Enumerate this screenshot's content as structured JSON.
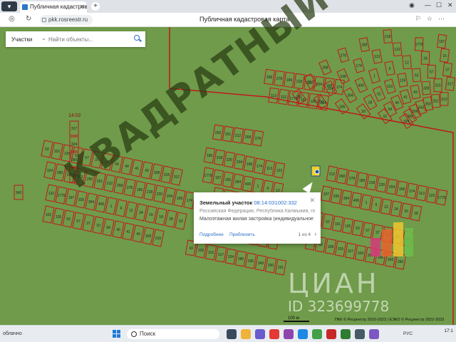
{
  "browser": {
    "tab_title": "Публичная кадастровая",
    "url": "pkk.rosreestr.ru",
    "page_title": "Публичная кадастровая карта"
  },
  "search": {
    "type_label": "Участки",
    "placeholder": "Найти объекты..."
  },
  "map": {
    "block_label": "14:02",
    "parcel_labels": [
      "52",
      "101",
      "126",
      "53",
      "57",
      "37",
      "10",
      "54",
      "40",
      "41",
      "43",
      "328",
      "315",
      "317",
      "324",
      "280",
      "296",
      "343",
      "250",
      "251",
      "212",
      "268",
      "278",
      "189",
      "218",
      "220",
      "204",
      "168",
      "174",
      "113",
      "122",
      "1779",
      "197",
      "335",
      "394",
      "406",
      "1",
      "6",
      "12",
      "24",
      "16",
      "18",
      "28"
    ],
    "boundary_color": "#c0191b",
    "parcel_color": "#c0191b",
    "map_color": "#6f9b4a"
  },
  "popup": {
    "heading": "Земельный участок",
    "cadastral_number": "08:14:031002:332",
    "address": "Российская Федерация, Республика Калмыкия, горо...",
    "use": "Малоэтажная жилая застройка (индивидуальное ж...",
    "details_link": "Подробнее",
    "zoom_link": "Приблизить",
    "page": "1 из 4"
  },
  "watermarks": {
    "agency": "КВАДРАТНЫЙ МЕТР",
    "cian": "ЦИАН",
    "listing_id": "ID 323699778"
  },
  "scale_label": "100 м",
  "copyright": "ПКК © Росреестр 2010-2023 | ЕЭКО © Росреестр 2022-2023",
  "taskbar": {
    "weather": "облачно",
    "search_placeholder": "Поиск",
    "language": "РУС",
    "time": "17:1"
  }
}
